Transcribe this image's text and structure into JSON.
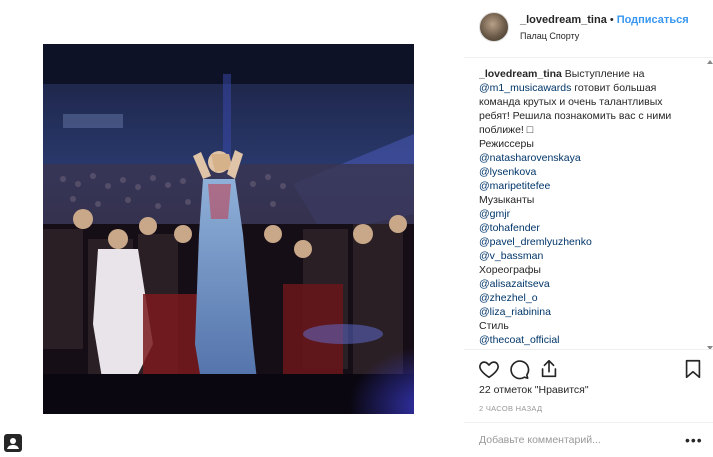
{
  "post": {
    "username": "_lovedream_tina",
    "separator": "•",
    "follow_label": "Подписаться",
    "location": "Палац Спорту"
  },
  "caption": {
    "lines": [
      {
        "text": "_lovedream_tina",
        "suffix": " Выступление на",
        "kind": "user"
      },
      {
        "text": "@m1_musicawards",
        "suffix": " готовит большая",
        "kind": "tag"
      },
      {
        "text": "команда крутых и очень талантливых",
        "kind": "plain"
      },
      {
        "text": "ребят! Решила познакомить вас с ними",
        "kind": "plain"
      },
      {
        "text": "поближе! □",
        "kind": "plain"
      },
      {
        "text": "Режиссеры",
        "kind": "plain"
      },
      {
        "text": "@natasharovenskaya",
        "kind": "tag"
      },
      {
        "text": "@lysenkova",
        "kind": "tag"
      },
      {
        "text": "@maripetitefee",
        "kind": "tag"
      },
      {
        "text": "Музыканты",
        "kind": "plain"
      },
      {
        "text": "@gmjr",
        "kind": "tag"
      },
      {
        "text": "@tohafender",
        "kind": "tag"
      },
      {
        "text": "@pavel_dremlyuzhenko",
        "kind": "tag"
      },
      {
        "text": "@v_bassman",
        "kind": "tag"
      },
      {
        "text": "Хореографы",
        "kind": "plain"
      },
      {
        "text": "@alisazaitseva",
        "kind": "tag"
      },
      {
        "text": "@zhezhel_o",
        "kind": "tag"
      },
      {
        "text": "@liza_riabinina",
        "kind": "tag"
      },
      {
        "text": "Стиль",
        "kind": "plain"
      },
      {
        "text": "@thecoat_official",
        "kind": "tag"
      }
    ]
  },
  "actions": {
    "like_icon": "heart-icon",
    "comment_icon": "comment-icon",
    "share_icon": "share-icon",
    "save_icon": "bookmark-icon"
  },
  "likes_text": "22 отметок \"Нравится\"",
  "time_text": "2 ЧАСОВ НАЗАД",
  "comment": {
    "placeholder": "Добавьте комментарий...",
    "more_label": "•••"
  },
  "colors": {
    "link": "#3897f0",
    "tag": "#003569",
    "muted": "#999999"
  }
}
